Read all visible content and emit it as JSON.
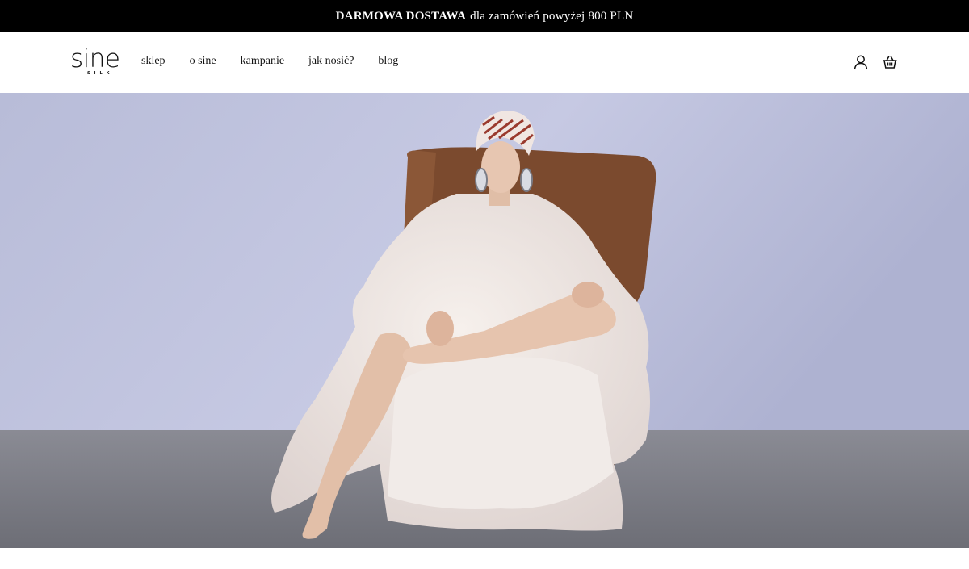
{
  "promo": {
    "bold_text": "DARMOWA DOSTAWA",
    "text": "dla zamówień powyżej 800 PLN"
  },
  "brand": {
    "name": "sine",
    "sub": "SILK"
  },
  "nav": {
    "items": [
      {
        "label": "sklep"
      },
      {
        "label": "o sine"
      },
      {
        "label": "kampanie"
      },
      {
        "label": "jak nosić?"
      },
      {
        "label": "blog"
      }
    ]
  },
  "header_icons": [
    "user-icon",
    "basket-icon"
  ],
  "colors": {
    "promo_bg": "#000000",
    "promo_text": "#ffffff",
    "wall": "#bfc3df",
    "floor": "#7d7e86",
    "chair": "#7b4a2e",
    "fur": "#efe7e3"
  }
}
